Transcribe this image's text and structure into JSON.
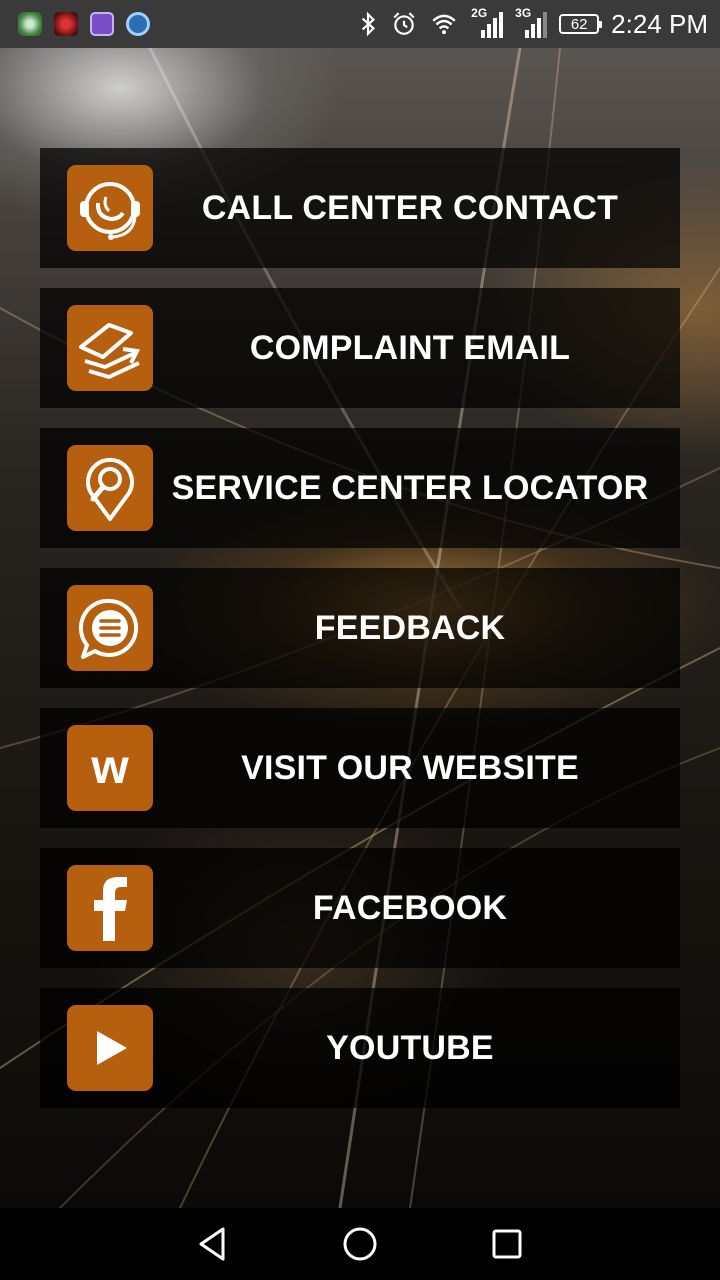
{
  "status_bar": {
    "notification_icons": [
      "media-app-icon",
      "game-app-icon",
      "gallery-app-icon",
      "chat-app-icon"
    ],
    "network_left": "2G",
    "network_right": "3G",
    "battery": "62",
    "time": "2:24 PM"
  },
  "menu": {
    "items": [
      {
        "label": "CALL CENTER CONTACT",
        "icon": "headset-icon"
      },
      {
        "label": "COMPLAINT EMAIL",
        "icon": "email-icon"
      },
      {
        "label": "SERVICE CENTER LOCATOR",
        "icon": "location-pin-icon"
      },
      {
        "label": "FEEDBACK",
        "icon": "chat-bubble-icon"
      },
      {
        "label": "VISIT OUR WEBSITE",
        "icon": "website-icon",
        "glyph": "w"
      },
      {
        "label": "FACEBOOK",
        "icon": "facebook-icon"
      },
      {
        "label": "YOUTUBE",
        "icon": "play-icon"
      }
    ]
  },
  "colors": {
    "icon_bg": "#b6600f",
    "button_bg": "rgba(0,0,0,0.72)",
    "status_bar": "#3a3a3a",
    "nav_bar": "#000000"
  },
  "nav_bar": {
    "back": "back-icon",
    "home": "home-icon",
    "recents": "recents-icon"
  }
}
